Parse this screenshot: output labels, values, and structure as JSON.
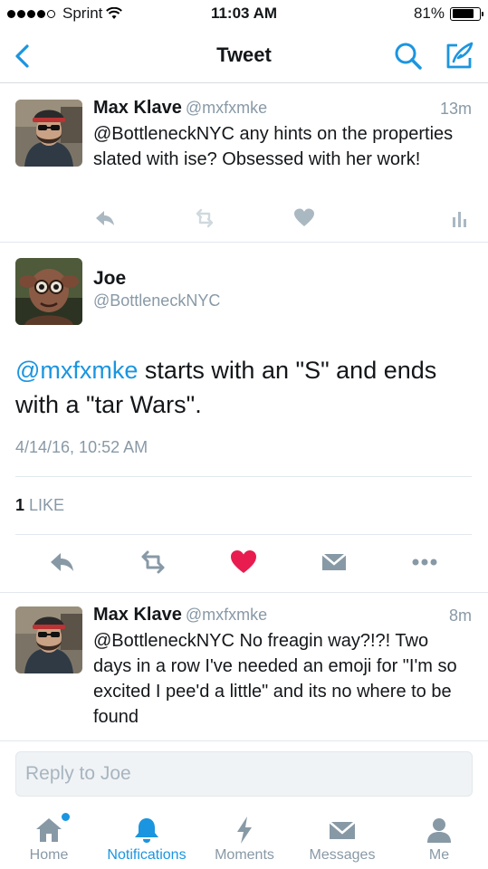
{
  "status_bar": {
    "carrier": "Sprint",
    "time": "11:03 AM",
    "battery": "81%",
    "battery_level": 0.81,
    "signal_bars": 4
  },
  "nav": {
    "title": "Tweet",
    "back_icon": "chevron-left-icon",
    "search_icon": "search-icon",
    "compose_icon": "compose-icon"
  },
  "tweets": [
    {
      "name": "Max Klave",
      "handle": "@mxfxmke",
      "time": "13m",
      "text": "@BottleneckNYC any hints on the properties slated with ise? Obsessed with her work!"
    },
    {
      "name": "Max Klave",
      "handle": "@mxfxmke",
      "time": "8m",
      "text": "@BottleneckNYC No freagin way?!?! Two days in a row I've needed an emoji for \"I'm so excited I pee'd a little\" and its no where to be found"
    }
  ],
  "focused_tweet": {
    "name": "Joe",
    "handle": "@BottleneckNYC",
    "mention": "@mxfxmke",
    "text": " starts with an \"S\" and ends with a \"tar Wars\".",
    "date": "4/14/16, 10:52 AM",
    "like_count": "1",
    "like_label": "LIKE"
  },
  "reply": {
    "placeholder": "Reply to Joe"
  },
  "tabs": [
    {
      "label": "Home",
      "icon": "home-icon"
    },
    {
      "label": "Notifications",
      "icon": "bell-icon"
    },
    {
      "label": "Moments",
      "icon": "lightning-icon"
    },
    {
      "label": "Messages",
      "icon": "envelope-icon"
    },
    {
      "label": "Me",
      "icon": "person-icon"
    }
  ],
  "colors": {
    "accent": "#1b95e0",
    "muted": "#8899a6",
    "action_gray": "#aab8c2",
    "like_red": "#e81c4f"
  }
}
